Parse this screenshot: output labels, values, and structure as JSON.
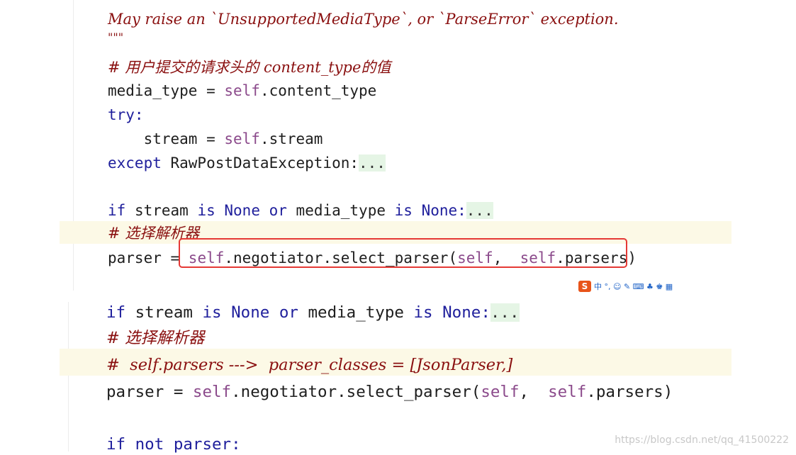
{
  "top_panel": {
    "docstring_line": "May raise an `UnsupportedMediaType`, or `ParseError` exception.",
    "docstring_close": "\"\"\"",
    "comment_content_type": "# 用户提交的请求头的 content_type的值",
    "line_media_type": {
      "lhs": "media_type = ",
      "self": "self",
      "rest": ".content_type"
    },
    "line_try": "try:",
    "line_stream": {
      "indent": "    stream = ",
      "self": "self",
      "rest": ".stream"
    },
    "line_except": {
      "kw": "except",
      "rest": " RawPostDataException:",
      "fold": "..."
    },
    "line_if": {
      "kw1": "if",
      "t1": " stream ",
      "kw2": "is",
      "t2": " None ",
      "kw3": "or",
      "t3": " media_type ",
      "kw4": "is",
      "t4": " None:",
      "fold": "..."
    },
    "comment_select": "# 选择解析器",
    "line_parser": {
      "lhs": "parser = ",
      "self1": "self",
      "mid": ".negotiator.select_parser(",
      "self2": "self",
      "comma": ",  ",
      "self3": "self",
      "end": ".parsers)"
    }
  },
  "bottom_panel": {
    "line_if": {
      "kw1": "if",
      "t1": " stream ",
      "kw2": "is",
      "t2": " None ",
      "kw3": "or",
      "t3": " media_type ",
      "kw4": "is",
      "t4": " None:",
      "fold": "..."
    },
    "comment_select": "# 选择解析器",
    "comment_parsers": "#  self.parsers --->  parser_classes = [JsonParser,]",
    "line_parser": {
      "lhs": "parser = ",
      "self1": "self",
      "mid": ".negotiator.select_parser(",
      "self2": "self",
      "comma": ",  ",
      "self3": "self",
      "end": ".parsers)"
    },
    "line_if_not": "if not parser:"
  },
  "ime_toolbar": {
    "logo": "S",
    "items": "中 °, ☺ ✎ ⌨ ♣ ♚ ▦"
  },
  "watermark": "https://blog.csdn.net/qq_41500222",
  "colors": {
    "keyword": "#1f1f9c",
    "comment": "#8a1010",
    "self": "#8b4a8b",
    "highlight": "#fcf9e6",
    "box": "#e53935"
  }
}
